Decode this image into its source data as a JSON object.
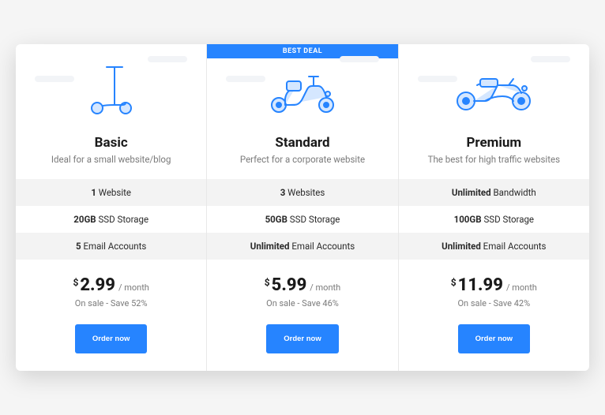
{
  "badge": "BEST DEAL",
  "plans": [
    {
      "icon": "scooter",
      "title": "Basic",
      "subtitle": "Ideal for a small website/blog",
      "features": [
        {
          "bold": "1",
          "rest": " Website"
        },
        {
          "bold": "20GB",
          "rest": " SSD Storage"
        },
        {
          "bold": "5",
          "rest": " Email Accounts"
        }
      ],
      "currency": "$",
      "price": "2.99",
      "period": "/ month",
      "sale": "On sale - Save 52%",
      "cta": "Order now"
    },
    {
      "icon": "moped",
      "title": "Standard",
      "subtitle": "Perfect for a corporate website",
      "badge": true,
      "features": [
        {
          "bold": "3",
          "rest": " Websites"
        },
        {
          "bold": "50GB",
          "rest": " SSD Storage"
        },
        {
          "bold": "Unlimited",
          "rest": " Email Accounts"
        }
      ],
      "currency": "$",
      "price": "5.99",
      "period": "/ month",
      "sale": "On sale - Save 46%",
      "cta": "Order now"
    },
    {
      "icon": "motorcycle",
      "title": "Premium",
      "subtitle": "The best for high traffic websites",
      "features": [
        {
          "bold": "Unlimited",
          "rest": " Bandwidth"
        },
        {
          "bold": "100GB",
          "rest": " SSD Storage"
        },
        {
          "bold": "Unlimited",
          "rest": " Email Accounts"
        }
      ],
      "currency": "$",
      "price": "11.99",
      "period": "/ month",
      "sale": "On sale - Save 42%",
      "cta": "Order now"
    }
  ]
}
